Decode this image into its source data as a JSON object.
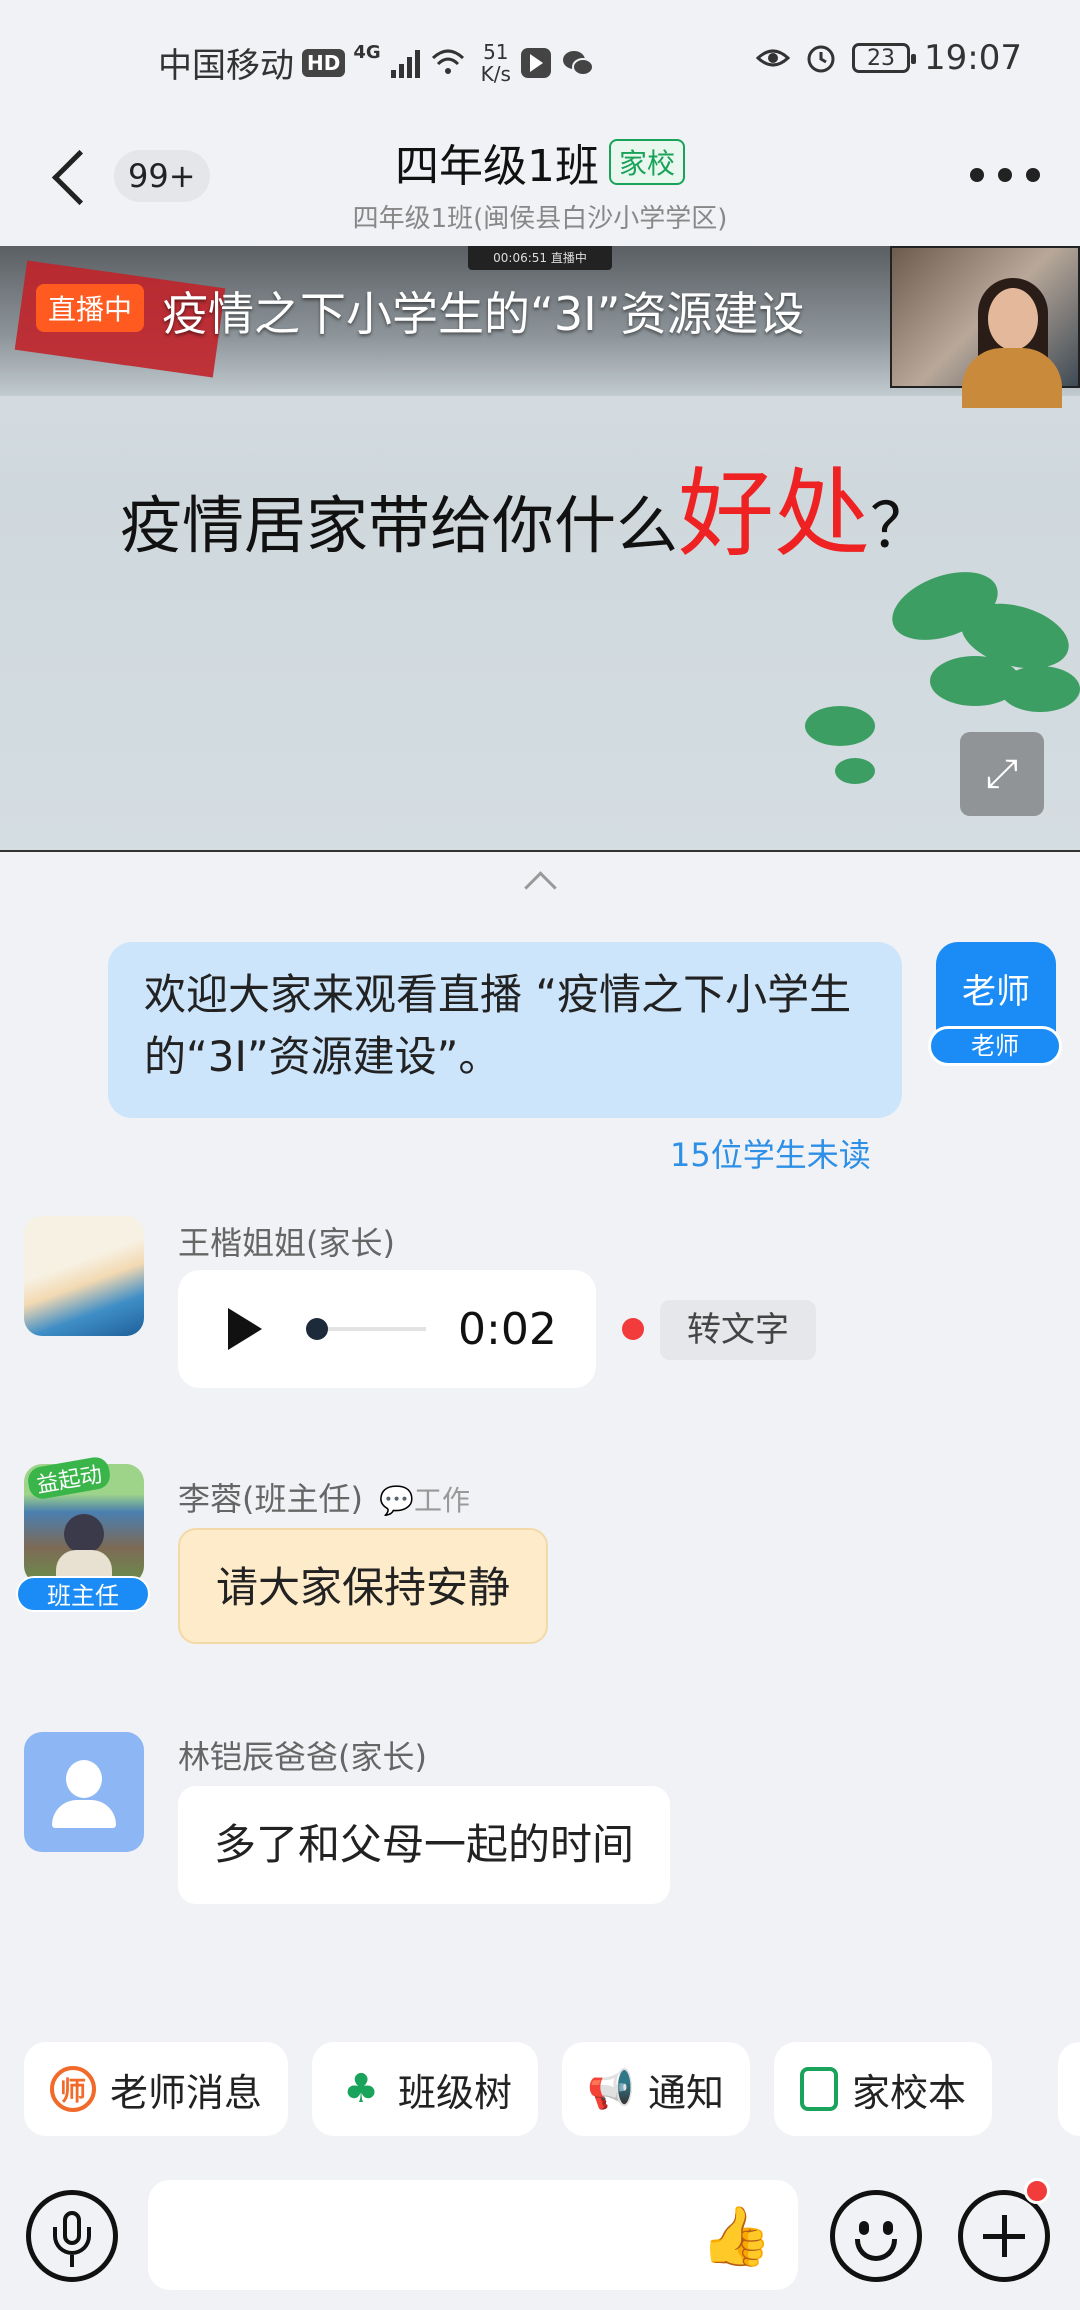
{
  "status_bar": {
    "carrier": "中国移动",
    "hd": "HD",
    "signal": "4G",
    "net_speed_value": "51",
    "net_speed_unit": "K/s",
    "battery": "23",
    "time": "19:07"
  },
  "header": {
    "unread_badge": "99+",
    "title": "四年级1班",
    "tag": "家校",
    "subtitle": "四年级1班(闽侯县白沙小学学区)"
  },
  "video": {
    "live_label": "直播中",
    "timer": "00:06:51 直播中",
    "slide_title": "疫情之下小学生的“3I”资源建设",
    "question_prefix": "疫情居家带给你什么",
    "question_highlight": "好处",
    "question_suffix": "？"
  },
  "messages": {
    "teacher_message": "欢迎大家来观看直播 “疫情之下小学生的“3I”资源建设”。",
    "teacher_avatar_name": "老师",
    "teacher_avatar_role": "老师",
    "unread_count": "15位学生未读",
    "msg1_sender": "王楷姐姐(家长)",
    "msg1_duration": "0:02",
    "msg1_to_text": "转文字",
    "msg2_sender": "李蓉(班主任)",
    "msg2_work": "工作",
    "msg2_avatar_badge": "班主任",
    "msg2_avatar_top": "益起动",
    "msg2_text": "请大家保持安静",
    "msg3_sender": "林铠辰爸爸(家长)",
    "msg3_text": "多了和父母一起的时间"
  },
  "shortcuts": [
    {
      "label": "老师消息",
      "icon": "teacher-message-icon"
    },
    {
      "label": "班级树",
      "icon": "class-tree-icon"
    },
    {
      "label": "通知",
      "icon": "megaphone-icon"
    },
    {
      "label": "家校本",
      "icon": "notebook-icon"
    }
  ],
  "input_bar": {
    "placeholder": ""
  },
  "colors": {
    "accent_blue": "#1b8cf5",
    "live_orange": "#ff5a1f",
    "brand_green": "#19a25a"
  }
}
